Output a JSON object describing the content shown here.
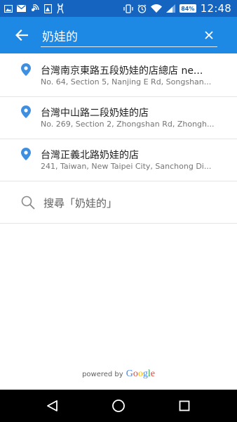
{
  "status_bar": {
    "battery": "84%",
    "time": "12:48",
    "notification_icons": [
      "image-icon",
      "mail-icon",
      "signal-icon",
      "photo-icon",
      "deer-icon"
    ],
    "system_icons": [
      "vibrate-icon",
      "alarm-icon",
      "wifi-icon",
      "cell-signal-icon",
      "battery-icon"
    ]
  },
  "search": {
    "query": "奶娃的",
    "back_icon": "back-arrow-icon",
    "clear_icon": "close-icon"
  },
  "results": [
    {
      "title": "台灣南京東路五段奶娃的店總店 ne...",
      "subtitle": "No. 64, Section 5, Nanjing E Rd, Songshan..."
    },
    {
      "title": "台灣中山路二段奶娃的店",
      "subtitle": "No. 269, Section 2, Zhongshan Rd, Zhongh..."
    },
    {
      "title": "台灣正義北路奶娃的店",
      "subtitle": "241, Taiwan, New Taipei City, Sanchong Di..."
    }
  ],
  "search_suggestion": "搜尋「奶娃的」",
  "attribution": {
    "label": "powered by",
    "logo_text": "Google"
  },
  "colors": {
    "status_bar": "#1565c0",
    "app_bar": "#1e88e5",
    "pin": "#3f8fe0",
    "nav_bar": "#000000"
  }
}
